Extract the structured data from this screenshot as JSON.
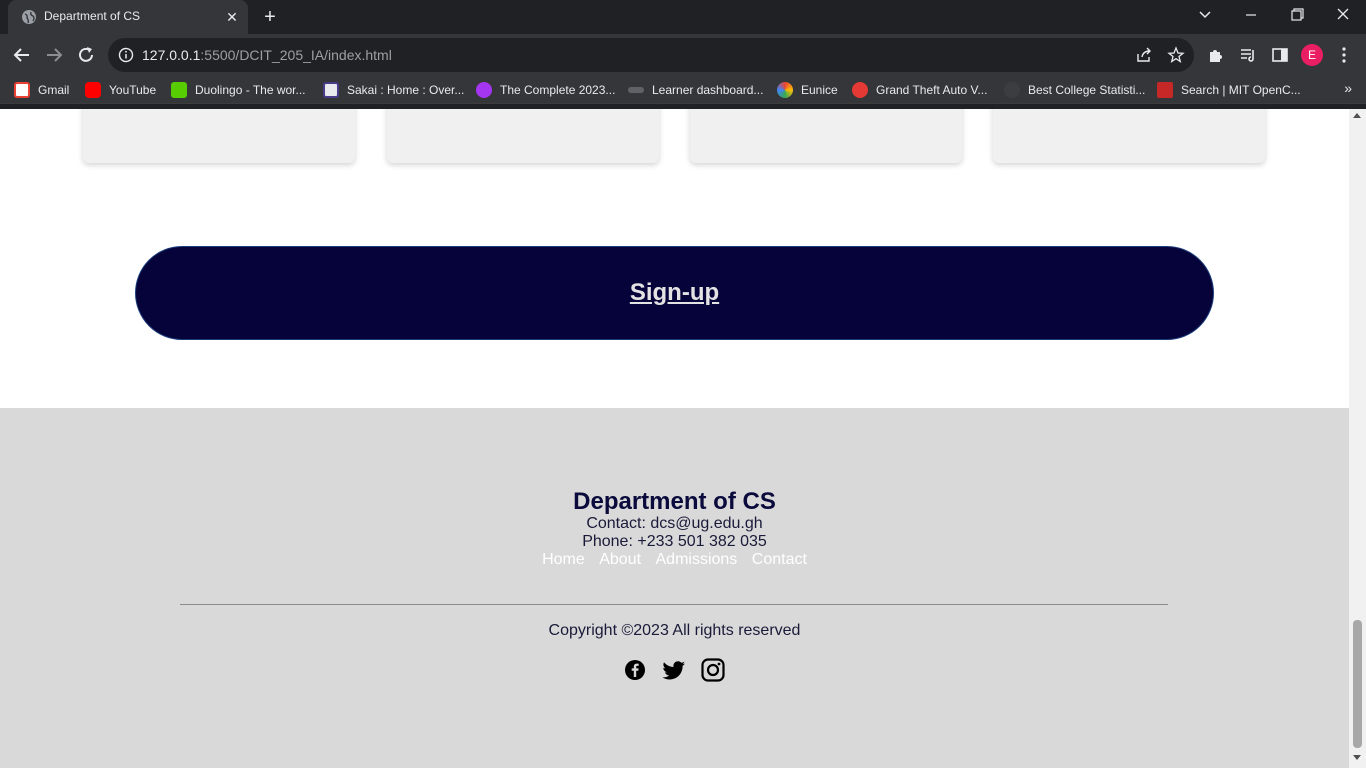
{
  "browser": {
    "tab_title": "Department of CS",
    "url_host": "127.0.0.1",
    "url_rest": ":5500/DCIT_205_IA/index.html",
    "profile_initial": "E",
    "bookmarks": [
      {
        "label": "Gmail",
        "icon": "gmail-icon",
        "color": "#ea4335"
      },
      {
        "label": "YouTube",
        "icon": "youtube-icon",
        "color": "#ff0000"
      },
      {
        "label": "Duolingo - The wor...",
        "icon": "duolingo-icon",
        "color": "#58cc02"
      },
      {
        "label": "Sakai : Home : Over...",
        "icon": "sakai-icon",
        "color": "#e8eaed"
      },
      {
        "label": "The Complete 2023...",
        "icon": "udemy-icon",
        "color": "#a435f0"
      },
      {
        "label": "Learner dashboard...",
        "icon": "alx-icon",
        "color": "#5f6368"
      },
      {
        "label": "Eunice",
        "icon": "eunice-icon",
        "color": "#ff9800"
      },
      {
        "label": "Grand Theft Auto V...",
        "icon": "gta-icon",
        "color": "#e53935"
      },
      {
        "label": "Best College Statisti...",
        "icon": "globe-icon",
        "color": "#35363a"
      },
      {
        "label": "Search | MIT OpenC...",
        "icon": "mit-icon",
        "color": "#c62828"
      }
    ]
  },
  "page": {
    "signup_label": "Sign-up",
    "footer": {
      "title": "Department of CS",
      "contact": "Contact: dcs@ug.edu.gh",
      "phone": "Phone: +233 501 382 035",
      "links": [
        "Home",
        "About",
        "Admissions",
        "Contact"
      ],
      "copyright": "Copyright ©2023 All rights reserved",
      "social_icons": [
        "facebook-icon",
        "twitter-icon",
        "instagram-icon"
      ]
    }
  },
  "colors": {
    "signup_bg": "#06033a",
    "footer_bg": "#d9d9d9",
    "title_color": "#0a0a3c",
    "chrome_bg": "#35363a"
  }
}
